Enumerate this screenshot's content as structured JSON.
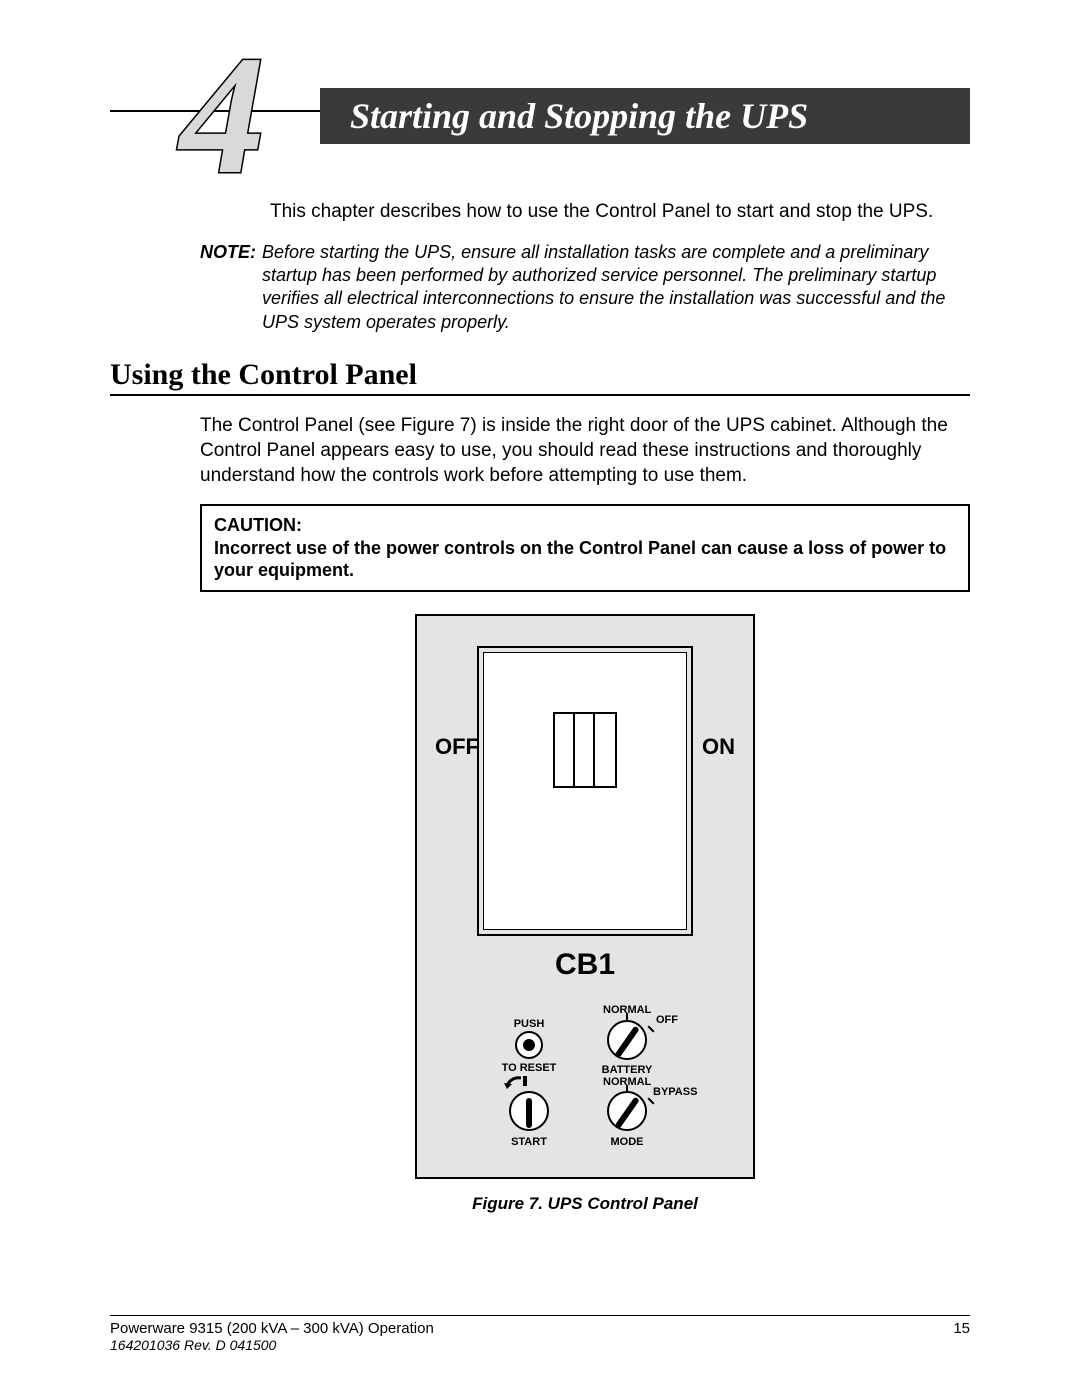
{
  "chapter": {
    "number": "4",
    "title": "Starting and Stopping the UPS"
  },
  "intro": "This chapter describes how to use the Control Panel to start and stop the UPS.",
  "note": {
    "label": "NOTE:",
    "text": "Before starting the UPS, ensure all installation tasks are complete and a preliminary startup has been performed by authorized service personnel.  The preliminary startup verifies all electrical interconnections to ensure the installation was successful and the UPS system operates properly."
  },
  "section_heading": "Using the Control Panel",
  "section_body": "The Control Panel (see Figure 7) is inside the right door of the UPS cabinet. Although the Control Panel appears easy to use, you should read these instructions and thoroughly understand how the controls work before attempting to use them.",
  "caution": {
    "label": "CAUTION:",
    "text": "Incorrect use of the power controls on the Control Panel can cause a loss of power to your equipment."
  },
  "panel": {
    "off": "OFF",
    "on": "ON",
    "breaker": "CB1",
    "push": "PUSH",
    "to_reset": "TO RESET",
    "start": "START",
    "battery_normal": "NORMAL",
    "battery_off": "OFF",
    "battery": "BATTERY",
    "mode_normal": "NORMAL",
    "mode_bypass": "BYPASS",
    "mode": "MODE"
  },
  "figure_caption": "Figure 7.  UPS Control Panel",
  "footer": {
    "line1": "Powerware 9315 (200 kVA – 300 kVA) Operation",
    "page": "15",
    "line2": "164201036  Rev. D  041500"
  }
}
